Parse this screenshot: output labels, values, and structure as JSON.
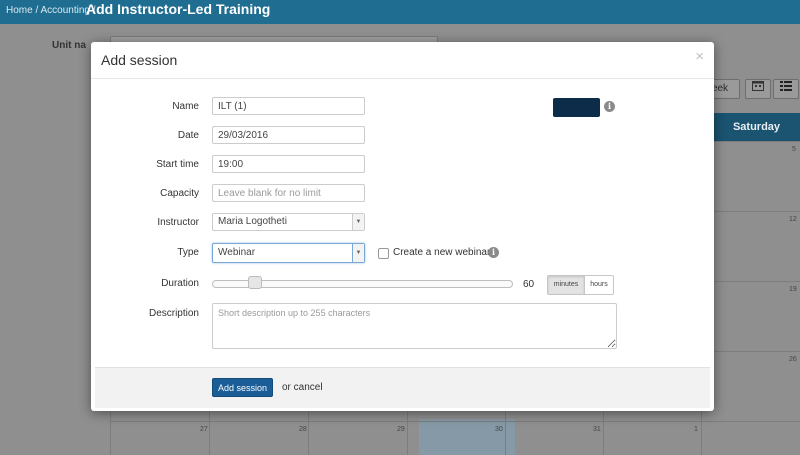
{
  "breadcrumb": {
    "home": "Home",
    "sep1": "/",
    "section": "Accounting",
    "sep2": "/"
  },
  "page_title": "Add Instructor-Led Training",
  "background": {
    "unit_label": "Unit na",
    "week_button": "eek",
    "calendar_header": "Saturday",
    "day_numbers": [
      "5",
      "12",
      "19",
      "26",
      "27",
      "28",
      "29",
      "30",
      "31",
      "1"
    ]
  },
  "modal": {
    "title": "Add session",
    "close_symbol": "×",
    "fields": {
      "name": {
        "label": "Name",
        "value": "ILT (1)"
      },
      "date": {
        "label": "Date",
        "value": "29/03/2016"
      },
      "start_time": {
        "label": "Start time",
        "value": "19:00"
      },
      "capacity": {
        "label": "Capacity",
        "value": "",
        "placeholder": "Leave blank for no limit"
      },
      "instructor": {
        "label": "Instructor",
        "value": "Maria Logotheti"
      },
      "type": {
        "label": "Type",
        "value": "Webinar"
      },
      "duration": {
        "label": "Duration",
        "value": "60",
        "unit_minutes": "minutes",
        "unit_hours": "hours"
      },
      "description": {
        "label": "Description",
        "value": "",
        "placeholder": "Short description up to 255 characters"
      }
    },
    "create_webinar_label": "Create a new webinar",
    "create_webinar_checked": false,
    "session_color": "#0d2c4a",
    "footer": {
      "submit_label": "Add session",
      "cancel_text": "or cancel"
    }
  },
  "icons": {
    "info": "info-icon",
    "close": "close-icon",
    "dropdown": "chevron-down-icon"
  },
  "colors": {
    "topbar": "#1f6e92",
    "primary_button": "#1b5d96",
    "calendar_header": "#1a5470"
  }
}
